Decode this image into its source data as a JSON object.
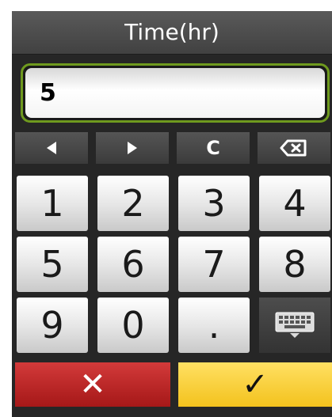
{
  "dialog": {
    "title": "Time(hr)",
    "input_value": "5"
  },
  "edit_row": {
    "left_icon": "left-arrow-icon",
    "right_icon": "right-arrow-icon",
    "clear_label": "C",
    "backspace_icon": "backspace-icon"
  },
  "keypad": {
    "keys": [
      "1",
      "2",
      "3",
      "4",
      "5",
      "6",
      "7",
      "8",
      "9",
      "0",
      "."
    ],
    "keyboard_icon": "keyboard-icon"
  },
  "actions": {
    "cancel_label": "✕",
    "confirm_label": "✓"
  },
  "colors": {
    "field_border": "#6f9a1e",
    "cancel": "#c62828",
    "confirm": "#f5c518"
  }
}
